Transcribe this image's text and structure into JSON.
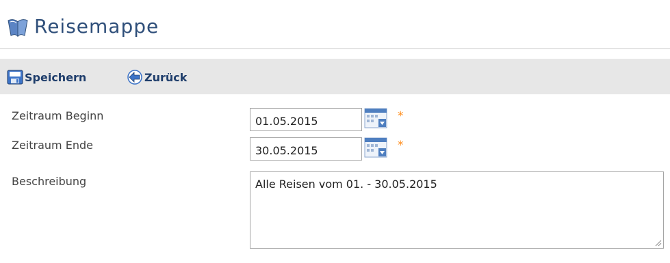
{
  "header": {
    "title": "Reisemappe",
    "icon": "book-icon"
  },
  "toolbar": {
    "save_label": "Speichern",
    "back_label": "Zurück"
  },
  "form": {
    "start": {
      "label": "Zeitraum Beginn",
      "value": "01.05.2015",
      "required_mark": "*"
    },
    "end": {
      "label": "Zeitraum Ende",
      "value": "30.05.2015",
      "required_mark": "*"
    },
    "description": {
      "label": "Beschreibung",
      "value": "Alle Reisen vom 01. - 30.05.2015"
    }
  },
  "colors": {
    "title": "#2f4f7a",
    "toolbar_bg": "#e7e7e7",
    "required": "#ff8c1a",
    "toolbar_text": "#1e3d6b"
  }
}
